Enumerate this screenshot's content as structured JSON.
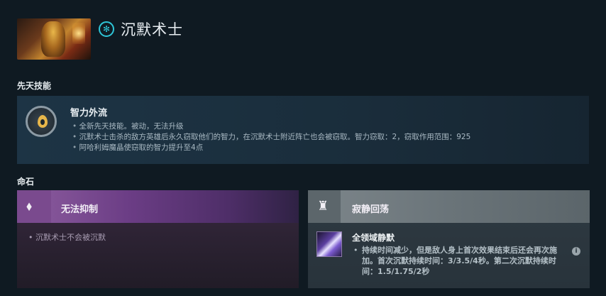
{
  "header": {
    "hero_name": "沉默术士",
    "portrait_icon": "hero-portrait",
    "attribute_icon": "universal-attribute-icon",
    "attribute_color": "#2ec6d8"
  },
  "innate": {
    "section_title": "先天技能",
    "name": "智力外流",
    "icon": "intelligence-drain-icon",
    "lines": [
      "全新先天技能。被动，无法升级",
      "沉默术士击杀的敌方英雄后永久窃取他们的智力，在沉默术士附近阵亡也会被窃取。智力窃取：2，窃取作用范围：925",
      "阿哈利姆魔晶使窃取的智力提升至4点"
    ]
  },
  "facets": {
    "section_title": "命石",
    "left": {
      "name": "无法抑制",
      "icon": "crystal-facet-icon",
      "color": "#8e5ea0",
      "description": "沉默术士不会被沉默"
    },
    "right": {
      "name": "寂静回荡",
      "icon": "echo-facet-icon",
      "color": "#7d868b",
      "ability_name": "全领域静默",
      "ability_icon": "global-silence-icon",
      "ability_description": "持续时间减少，但是敌人身上首次效果结束后还会再次施加。首次沉默持续时间：3/3.5/4秒。第二次沉默持续时间：1.5/1.75/2秒",
      "info_icon": "info-icon"
    }
  }
}
